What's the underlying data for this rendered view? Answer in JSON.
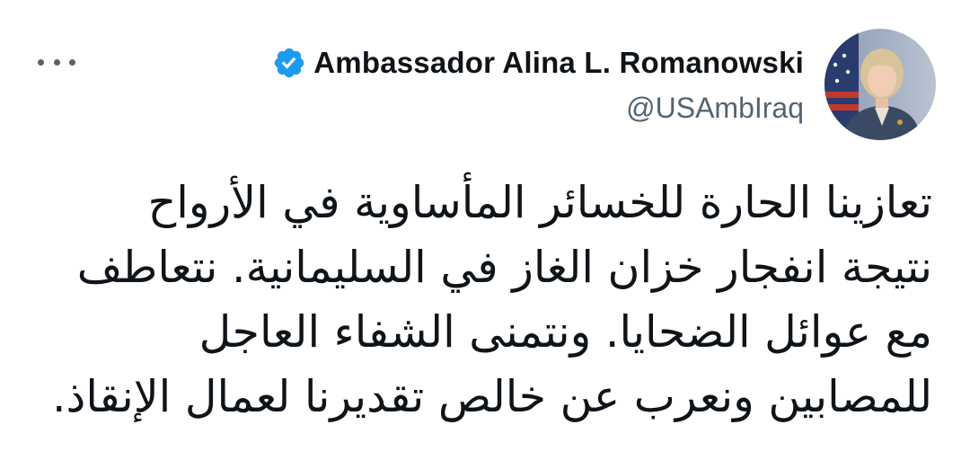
{
  "tweet": {
    "author": {
      "display_name": "Ambassador Alina L. Romanowski",
      "handle": "@USAmbIraq",
      "verified": true,
      "avatar_icon": "profile-photo",
      "verified_icon": "verified-badge-icon"
    },
    "more_icon": "more-options-icon",
    "text_lines": [
      "تعازينا الحارة للخسائر المأساوية في الأرواح",
      "نتيجة انفجار خزان الغاز في السليمانية. نتعاطف",
      "مع عوائل الضحايا. ونتمنى الشفاء العاجل",
      "للمصابين ونعرب عن خالص تقديرنا لعمال الإنقاذ."
    ]
  },
  "colors": {
    "verified_blue": "#1d9bf0",
    "name_text": "#0f1419",
    "secondary_text": "#536471",
    "background": "#ffffff"
  }
}
